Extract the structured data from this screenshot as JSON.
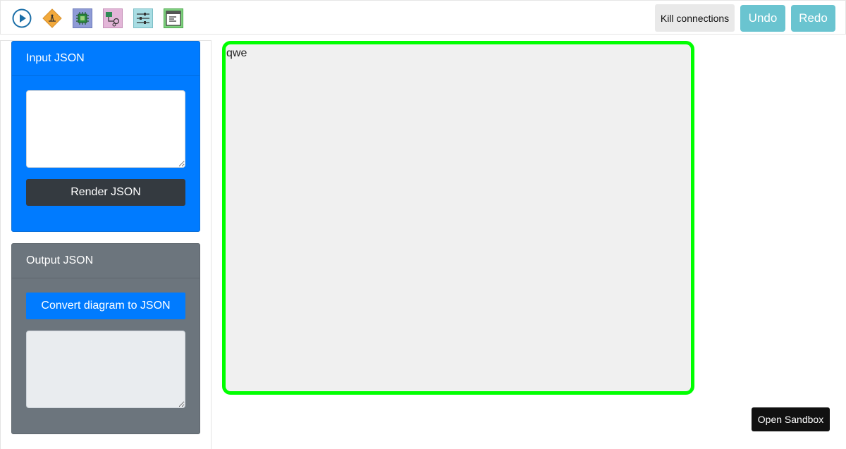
{
  "toolbar": {
    "icons": [
      "play-icon",
      "diamond-tool-icon",
      "chip-icon",
      "network-icon",
      "sliders-icon",
      "window-icon"
    ],
    "kill_label": "Kill connections",
    "undo_label": "Undo",
    "redo_label": "Redo"
  },
  "sidebar": {
    "input_card": {
      "title": "Input JSON",
      "textarea_value": "",
      "render_label": "Render JSON"
    },
    "output_card": {
      "title": "Output JSON",
      "convert_label": "Convert diagram to JSON",
      "textarea_value": ""
    }
  },
  "canvas": {
    "text": "qwe",
    "border_color": "#00ff00"
  },
  "sandbox": {
    "label": "Open Sandbox"
  },
  "colors": {
    "primary": "#007bff",
    "secondary": "#6c757d",
    "dark": "#343a40",
    "info": "#6ac4d0"
  }
}
